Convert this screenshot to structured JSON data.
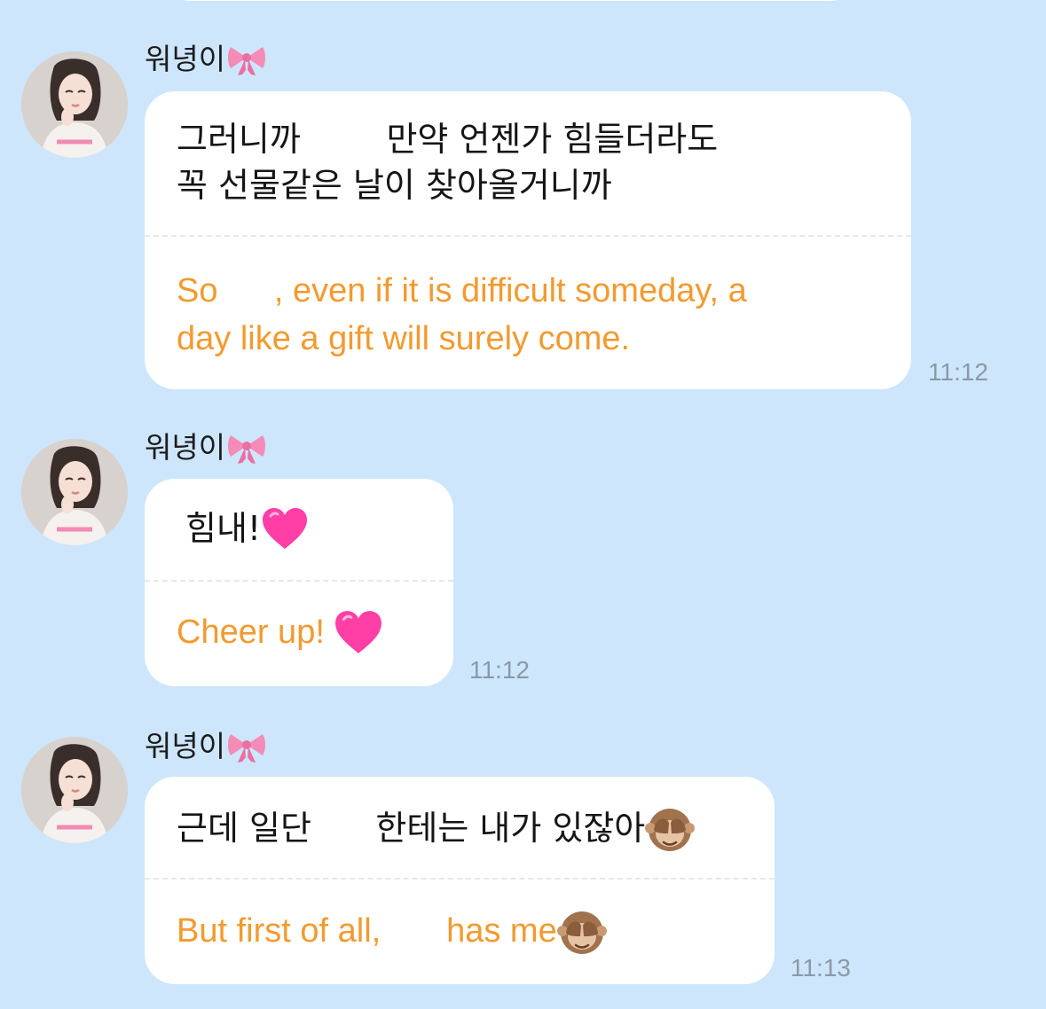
{
  "messages": [
    {
      "sender": "워녕이",
      "sender_badge_icon": "pink-ribbon-bow-icon",
      "original_text": "그러니까        만약 언젠가 힘들더라도\n꼭 선물같은 날이 찾아올거니까",
      "translated_text": "So      , even if it is difficult someday, a\nday like a gift will surely come.",
      "time": "11:12"
    },
    {
      "sender": "워녕이",
      "sender_badge_icon": "pink-ribbon-bow-icon",
      "original_text": "힘내!",
      "original_emoji": "pink-heart-icon",
      "translated_text": "Cheer up! ",
      "translated_emoji": "pink-heart-icon",
      "time": "11:12"
    },
    {
      "sender": "워녕이",
      "sender_badge_icon": "pink-ribbon-bow-icon",
      "original_text": "근데 일단      한테는 내가 있잖아",
      "original_emoji": "see-no-evil-monkey-icon",
      "translated_text": "But first of all,       has me",
      "translated_emoji": "see-no-evil-monkey-icon",
      "time": "11:13"
    }
  ],
  "colors": {
    "background": "#cde6fb",
    "bubble": "#ffffff",
    "translation_text": "#f39a2f",
    "timestamp": "#8a99a8",
    "heart": "#ff3fa6",
    "bow": "#f58bb7"
  }
}
